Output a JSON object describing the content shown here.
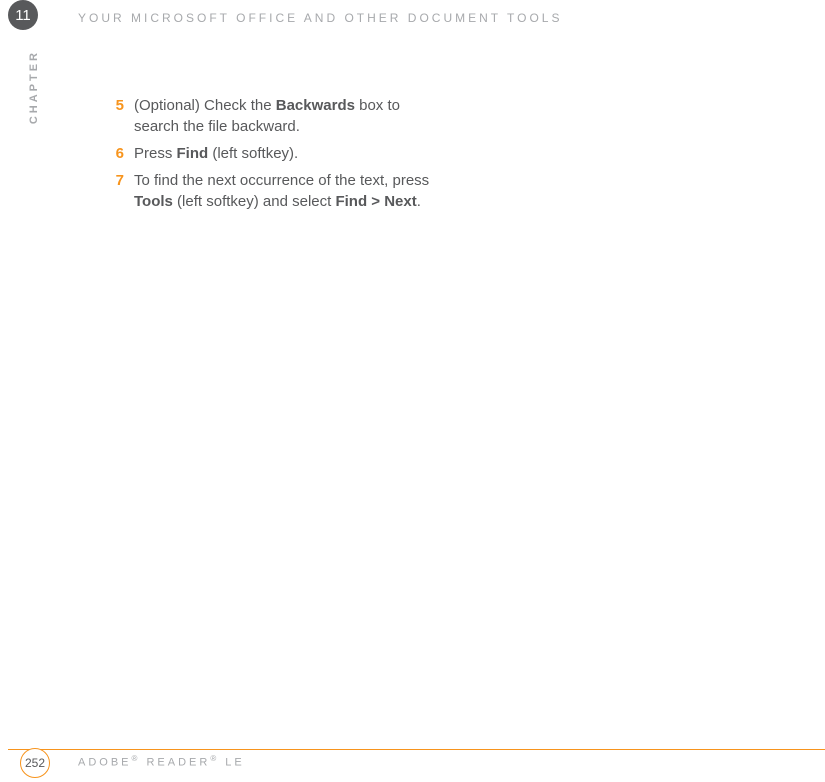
{
  "chapter": {
    "number": "11",
    "label": "CHAPTER",
    "title": "YOUR MICROSOFT OFFICE AND OTHER DOCUMENT TOOLS"
  },
  "steps": [
    {
      "num": "5",
      "parts": [
        {
          "text": "(Optional) Check the ",
          "bold": false
        },
        {
          "text": "Backwards",
          "bold": true
        },
        {
          "text": " box to search the file backward.",
          "bold": false
        }
      ]
    },
    {
      "num": "6",
      "parts": [
        {
          "text": "Press ",
          "bold": false
        },
        {
          "text": "Find",
          "bold": true
        },
        {
          "text": " (left softkey).",
          "bold": false
        }
      ]
    },
    {
      "num": "7",
      "parts": [
        {
          "text": "To find the next occurrence of the text, press ",
          "bold": false
        },
        {
          "text": "Tools",
          "bold": true
        },
        {
          "text": " (left softkey) and select ",
          "bold": false
        },
        {
          "text": "Find > Next",
          "bold": true
        },
        {
          "text": ".",
          "bold": false
        }
      ]
    }
  ],
  "footer": {
    "page": "252",
    "text_parts": [
      {
        "text": "ADOBE",
        "sup": false
      },
      {
        "text": "®",
        "sup": true
      },
      {
        "text": " READER",
        "sup": false
      },
      {
        "text": "®",
        "sup": true
      },
      {
        "text": " LE",
        "sup": false
      }
    ]
  }
}
